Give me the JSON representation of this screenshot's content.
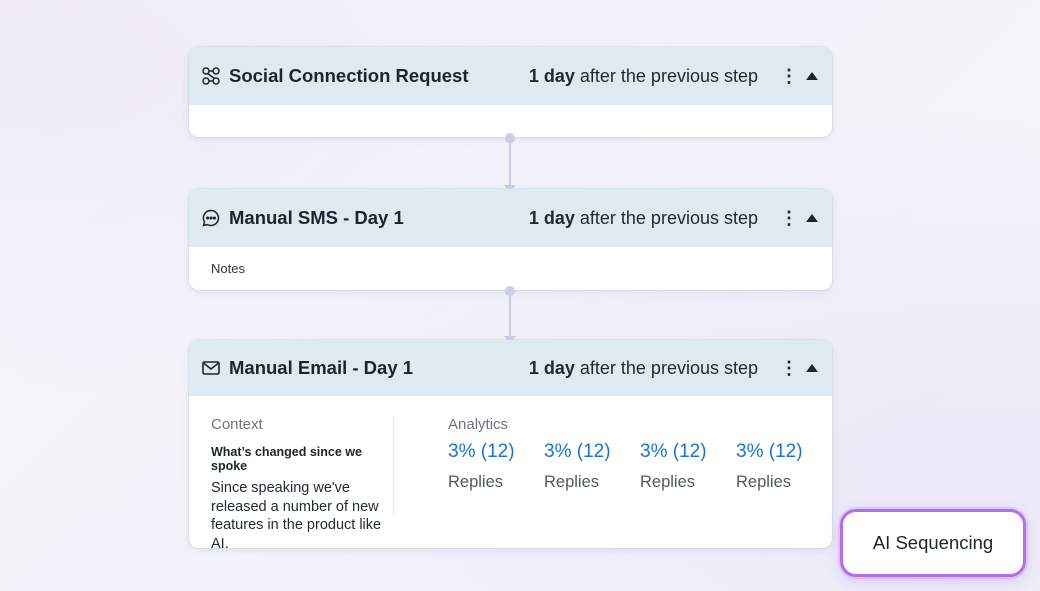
{
  "steps": [
    {
      "title": "Social Connection Request",
      "icon": "social-connection-icon",
      "timing_bold": "1 day",
      "timing_rest": " after the previous step"
    },
    {
      "title": "Manual SMS - Day 1",
      "icon": "chat-bubble-icon",
      "timing_bold": "1 day",
      "timing_rest": " after the previous step",
      "notes_label": "Notes"
    },
    {
      "title": "Manual Email - Day 1",
      "icon": "envelope-icon",
      "timing_bold": "1 day",
      "timing_rest": " after the previous step",
      "context": {
        "label": "Context",
        "heading": "What’s changed since we spoke",
        "text": "Since speaking we've released a number of new features in the product like AI."
      },
      "analytics": {
        "label": "Analytics",
        "metrics": [
          {
            "value": "3% (12)",
            "label": "Replies"
          },
          {
            "value": "3% (12)",
            "label": "Replies"
          },
          {
            "value": "3% (12)",
            "label": "Replies"
          },
          {
            "value": "3% (12)",
            "label": "Replies"
          }
        ]
      }
    }
  ],
  "menu_glyph": "⋮",
  "badge": {
    "label": "AI Sequencing"
  },
  "colors": {
    "header_bg": "#dfe9f1",
    "metric_blue": "#1a73d9",
    "connector": "#c9cde6",
    "badge_border": "#b46cf0"
  }
}
